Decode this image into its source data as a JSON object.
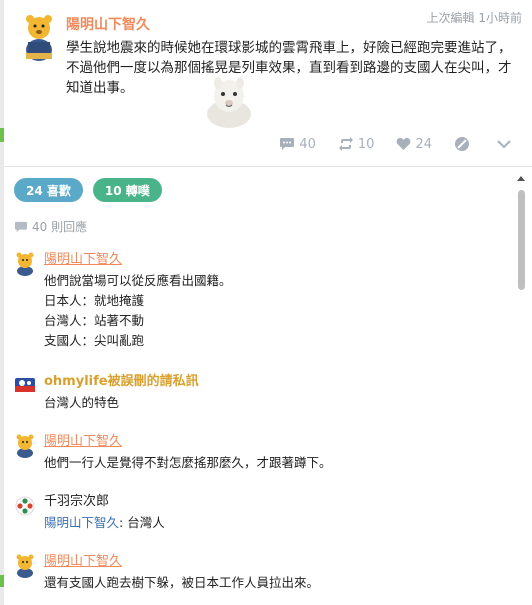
{
  "post": {
    "author": "陽明山下智久",
    "time": "上次編輯 1小時前",
    "body": "學生說地震來的時候她在環球影城的雲霄飛車上，好險已經跑完要進站了，不過他們一度以為那個搖晃是列車效果，直到看到路邊的支國人在尖叫，才知道出事。",
    "actions": {
      "comments": "40",
      "reposts": "10",
      "likes": "24"
    }
  },
  "filters": {
    "likes_label": "24 喜歡",
    "shares_label": "10 轉噗"
  },
  "reply_count": "40 則回應",
  "comments": [
    {
      "author": "陽明山下智久",
      "lines": [
        "他們說當場可以從反應看出國籍。",
        "日本人：就地掩護",
        "台灣人：站著不動",
        "支國人：尖叫亂跑"
      ]
    },
    {
      "author": "ohmylife被誤刪的請私訊",
      "lines": [
        "台灣人的特色"
      ]
    },
    {
      "author": "陽明山下智久",
      "lines": [
        "他們一行人是覺得不對怎麼搖那麼久，才跟著蹲下。"
      ]
    },
    {
      "author": "千羽宗次郎",
      "reply_to": "陽明山下智久",
      "reply_text": ": 台灣人"
    },
    {
      "author": "陽明山下智久",
      "lines": [
        "還有支國人跑去樹下躲，被日本工作人員拉出來。"
      ]
    }
  ],
  "colors": {
    "accent_orange": "#f08a5d",
    "likes_pill": "#5aa9c8",
    "shares_pill": "#49b48a",
    "link_blue": "#3a6fb0"
  },
  "icons": {
    "comment": "comment-bubble-icon",
    "repost": "repost-icon",
    "like": "heart-icon",
    "mute": "mute-icon",
    "more": "chevron-down-icon"
  }
}
